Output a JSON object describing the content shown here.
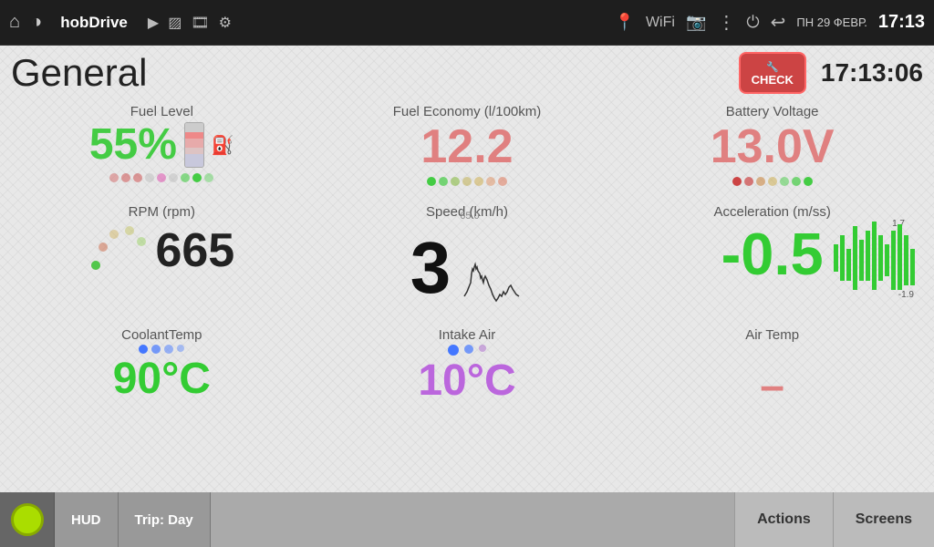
{
  "statusBar": {
    "appTitle": "hobDrive",
    "timeDisplay": "17:13",
    "dateDisplay": "ПН 29 ФЕВР."
  },
  "header": {
    "pageTitle": "General",
    "checkLabel": "CHECK",
    "timeValue": "17:13:06"
  },
  "metrics": {
    "fuelLevel": {
      "label": "Fuel Level",
      "value": "55%",
      "valueClass": "val-green"
    },
    "fuelEconomy": {
      "label": "Fuel Economy (l/100km)",
      "value": "12.2",
      "valueClass": "val-pink"
    },
    "batteryVoltage": {
      "label": "Battery Voltage",
      "value": "13.0V",
      "valueClass": "val-pink"
    },
    "rpm": {
      "label": "RPM (rpm)",
      "value": "665",
      "valueClass": "val-black"
    },
    "speed": {
      "label": "Speed (km/h)",
      "value": "3",
      "valueClass": "val-black",
      "chartValue": "65.0"
    },
    "acceleration": {
      "label": "Acceleration (m/ss)",
      "value": "-0.5",
      "valueClass": "val-green-bright",
      "subValue": "-1.9",
      "topValue": "1.7"
    },
    "coolantTemp": {
      "label": "CoolantTemp",
      "value": "90°C",
      "valueClass": "val-green-bright"
    },
    "intakeAir": {
      "label": "Intake Air",
      "value": "10°C",
      "valueClass": "val-purple"
    },
    "airTemp": {
      "label": "Air Temp",
      "value": "–",
      "valueClass": "val-pink"
    }
  },
  "bottomBar": {
    "circleBtn": "",
    "hudLabel": "HUD",
    "tripLabel": "Trip: Day",
    "actionsLabel": "Actions",
    "screensLabel": "Screens"
  }
}
